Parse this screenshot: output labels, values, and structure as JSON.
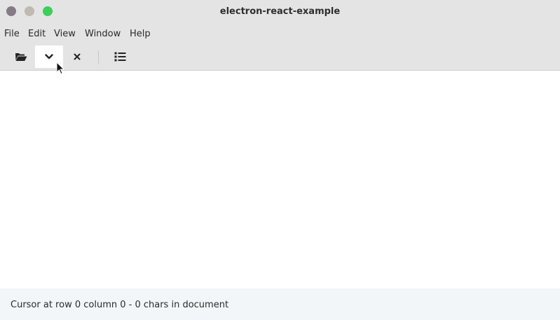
{
  "window": {
    "title": "electron-react-example"
  },
  "menubar": {
    "items": [
      {
        "label": "File"
      },
      {
        "label": "Edit"
      },
      {
        "label": "View"
      },
      {
        "label": "Window"
      },
      {
        "label": "Help"
      }
    ]
  },
  "toolbar": {
    "buttons": [
      {
        "icon": "folder-open-icon"
      },
      {
        "icon": "chevron-down-icon",
        "active": true
      },
      {
        "icon": "close-icon"
      },
      {
        "icon": "list-icon"
      }
    ]
  },
  "editor": {
    "content": ""
  },
  "statusbar": {
    "text": "Cursor at row 0 column 0 - 0 chars in document"
  },
  "colors": {
    "chrome": "#e4e4e4",
    "traffic_close": "#857a86",
    "traffic_minimize": "#bfbab1",
    "traffic_maximize": "#3cd05a",
    "statusbar_bg": "#f3f6f9"
  }
}
